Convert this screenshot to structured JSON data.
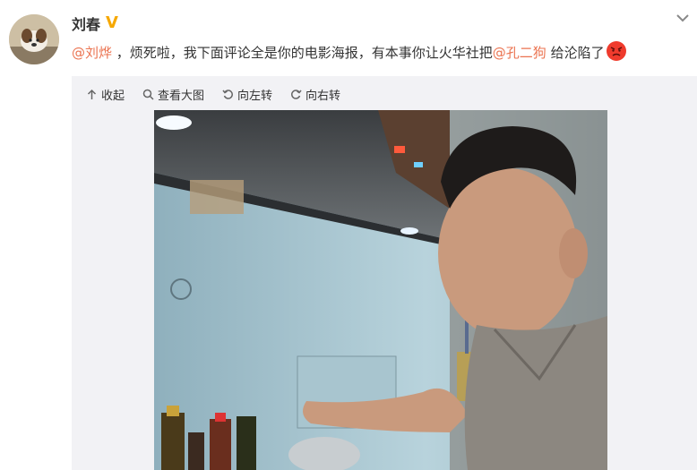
{
  "post": {
    "username": "刘春",
    "badge": "V",
    "mention_1": "@刘烨",
    "text_1": " ，烦死啦，我下面评论全是你的电影海报，有本事你让火华社把",
    "mention_2": "@孔二狗",
    "text_2": " 给沦陷了"
  },
  "toolbar": {
    "collapse": "收起",
    "view_large": "查看大图",
    "rotate_left": "向左转",
    "rotate_right": "向右转"
  },
  "colors": {
    "mention": "#eb7350",
    "badge": "#f6a800",
    "media_bg": "#f2f2f5"
  }
}
